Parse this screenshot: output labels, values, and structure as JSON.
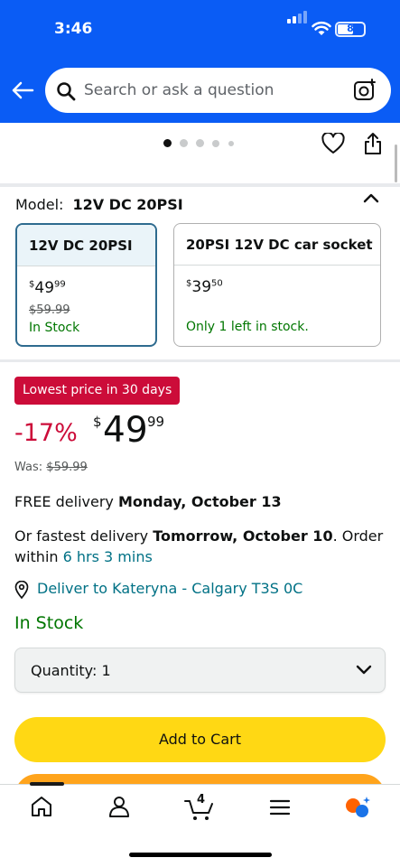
{
  "status_bar": {
    "time": "3:46",
    "battery": "8"
  },
  "search": {
    "placeholder": "Search or ask a question"
  },
  "icons": {
    "back": "back-arrow-icon",
    "search": "search-icon",
    "camera": "camera-search-icon",
    "wishlist": "heart-icon",
    "share": "share-icon",
    "collapse": "chevron-up-icon",
    "location": "location-pin-icon",
    "dropdown": "chevron-down-icon",
    "tabs": [
      "home-icon",
      "account-icon",
      "cart-icon",
      "menu-icon",
      "rufus-ai-icon"
    ]
  },
  "carousel": {
    "pages": 5,
    "active": 0
  },
  "model": {
    "label": "Model:",
    "selected": "12V DC 20PSI",
    "options": [
      {
        "name": "12V DC 20PSI",
        "price_sym": "$",
        "price_whole": "49",
        "price_frac": "99",
        "was": "$59.99",
        "stock": "In Stock"
      },
      {
        "name": "20PSI 12V DC car socket",
        "price_sym": "$",
        "price_whole": "39",
        "price_frac": "50",
        "was": "",
        "stock": "Only 1 left in stock."
      }
    ]
  },
  "deal": {
    "badge": "Lowest price in 30 days",
    "discount": "-17%"
  },
  "price": {
    "symbol": "$",
    "whole": "49",
    "fraction": "99"
  },
  "was": {
    "label": "Was:",
    "value": "$59.99"
  },
  "delivery": {
    "free_prefix": "FREE delivery",
    "free_date": "Monday, October 13",
    "fast_prefix": "Or fastest delivery",
    "fast_date": "Tomorrow, October 10",
    "order_text": ". Order",
    "within": "within",
    "countdown": "6 hrs 3 mins",
    "deliver_to": "Deliver to Kateryna - Calgary T3S 0C"
  },
  "stock": "In Stock",
  "quantity": {
    "label": "Quantity:",
    "value": "1"
  },
  "buttons": {
    "add_to_cart": "Add to Cart"
  },
  "tabbar": {
    "cart_count": "4"
  },
  "colors": {
    "brand_blue": "#0a5cf5",
    "deal_red": "#cc0c39",
    "stock_green": "#007600",
    "link_teal": "#007185",
    "cart_yellow": "#ffd814",
    "buy_orange": "#ffa41c"
  }
}
